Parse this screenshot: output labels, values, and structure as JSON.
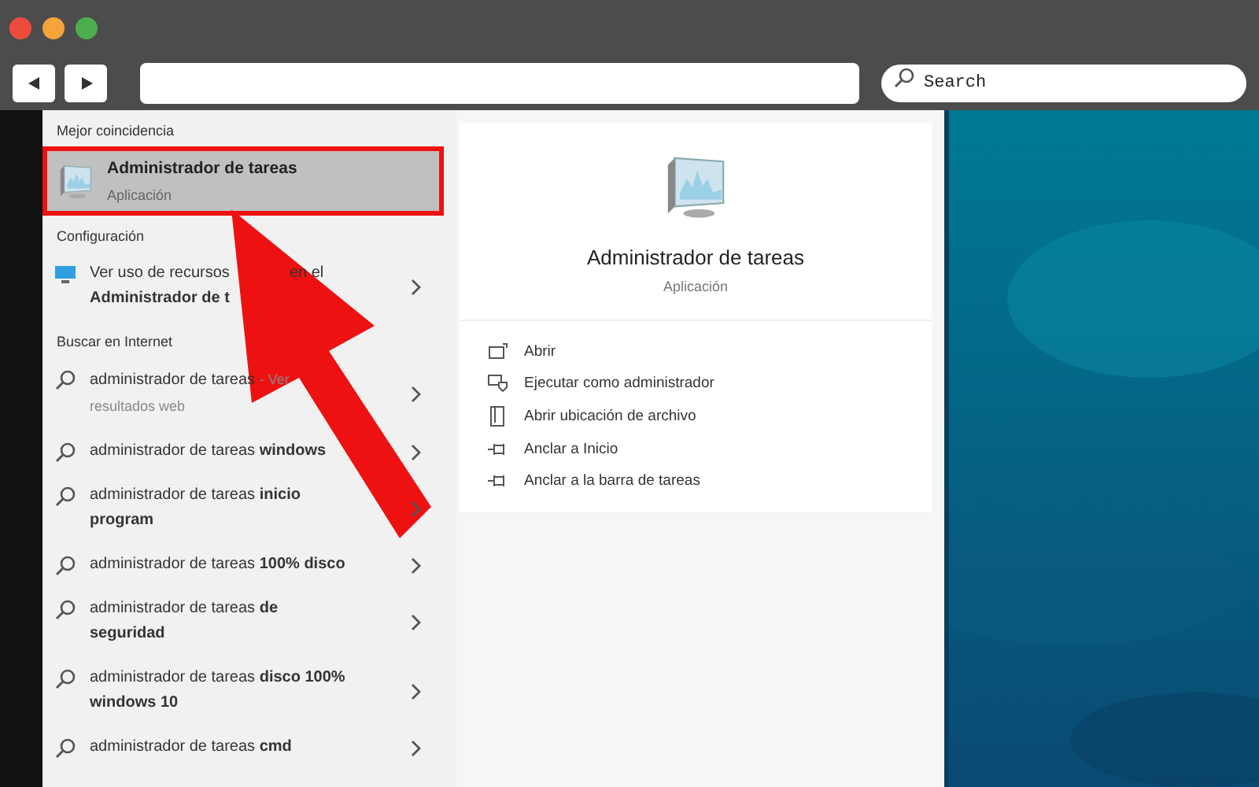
{
  "browser": {
    "search_placeholder": "Search"
  },
  "results": {
    "best_match": {
      "heading": "Mejor coincidencia",
      "title": "Administrador de tareas",
      "subtitle": "Aplicación",
      "selected": true
    },
    "settings": {
      "heading": "Configuración",
      "lines": [
        "Ver uso de recursos",
        "en el",
        "Administrador de t"
      ]
    },
    "web": {
      "heading": "Buscar en Internet",
      "items": [
        {
          "text": "administrador de tareas",
          "suffix": "- Ver",
          "second_line": "resultados web"
        },
        {
          "text": "administrador de tareas **windows**"
        },
        {
          "text": "administrador de tareas **inicio**",
          "second_line": "program"
        },
        {
          "text": "administrador de tareas **100% disco**"
        },
        {
          "text": "administrador de tareas **de**",
          "second_line": "seguridad"
        },
        {
          "text": "administrador de tareas **disco 100%**",
          "second_line": "windows 10"
        },
        {
          "text": "administrador de tareas **cmd**"
        }
      ]
    }
  },
  "detail": {
    "title": "Administrador de tareas",
    "subtitle": "Aplicación",
    "actions": [
      {
        "kind": "open",
        "label": "Abrir"
      },
      {
        "kind": "admin",
        "label": "Ejecutar como administrador"
      },
      {
        "kind": "folder",
        "label": "Abrir ubicación de archivo"
      },
      {
        "kind": "pin",
        "label": "Anclar a Inicio"
      },
      {
        "kind": "pin",
        "label": "Anclar a la barra de tareas"
      }
    ]
  }
}
